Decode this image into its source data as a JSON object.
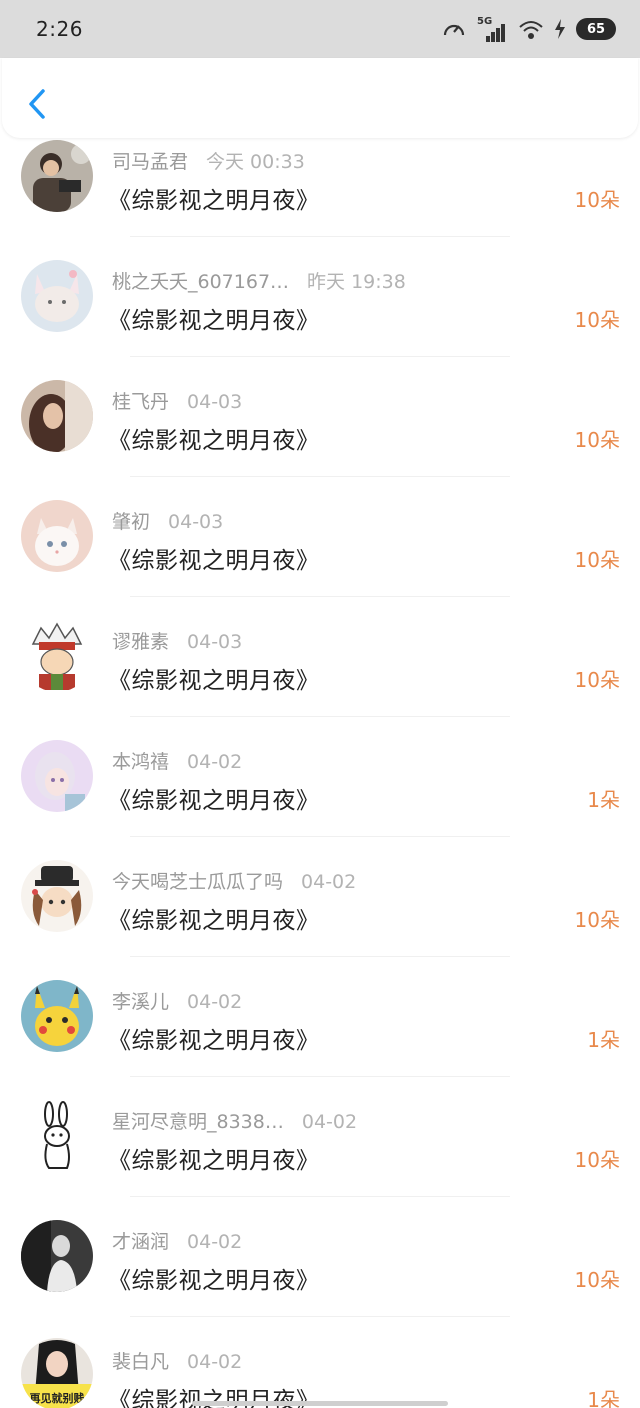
{
  "status_bar": {
    "time": "2:26",
    "network": "5G",
    "battery": "65"
  },
  "header": {
    "back_icon": "chevron-left-icon",
    "accent": "#2196F3"
  },
  "colors": {
    "amount": "#e8894b",
    "name": "#9a9a9a",
    "title": "#222222"
  },
  "records": [
    {
      "name": "司马孟君",
      "time": "今天 00:33",
      "title": "《综影视之明月夜》",
      "amount": "10朵"
    },
    {
      "name": "桃之夭夭_607167…",
      "time": "昨天 19:38",
      "title": "《综影视之明月夜》",
      "amount": "10朵"
    },
    {
      "name": "桂飞丹",
      "time": "04-03",
      "title": "《综影视之明月夜》",
      "amount": "10朵"
    },
    {
      "name": "肇初",
      "time": "04-03",
      "title": "《综影视之明月夜》",
      "amount": "10朵"
    },
    {
      "name": "谬雅素",
      "time": "04-03",
      "title": "《综影视之明月夜》",
      "amount": "10朵"
    },
    {
      "name": "本鸿禧",
      "time": "04-02",
      "title": "《综影视之明月夜》",
      "amount": "1朵"
    },
    {
      "name": "今天喝芝士瓜瓜了吗",
      "time": "04-02",
      "title": "《综影视之明月夜》",
      "amount": "10朵"
    },
    {
      "name": "李溪儿",
      "time": "04-02",
      "title": "《综影视之明月夜》",
      "amount": "1朵"
    },
    {
      "name": "星河尽意明_8338…",
      "time": "04-02",
      "title": "《综影视之明月夜》",
      "amount": "10朵"
    },
    {
      "name": "才涵润",
      "time": "04-02",
      "title": "《综影视之明月夜》",
      "amount": "10朵"
    },
    {
      "name": "裴白凡",
      "time": "04-02",
      "title": "《综影视之明月夜》",
      "amount": "1朵"
    }
  ],
  "avatar_badge": "再见就别贱"
}
